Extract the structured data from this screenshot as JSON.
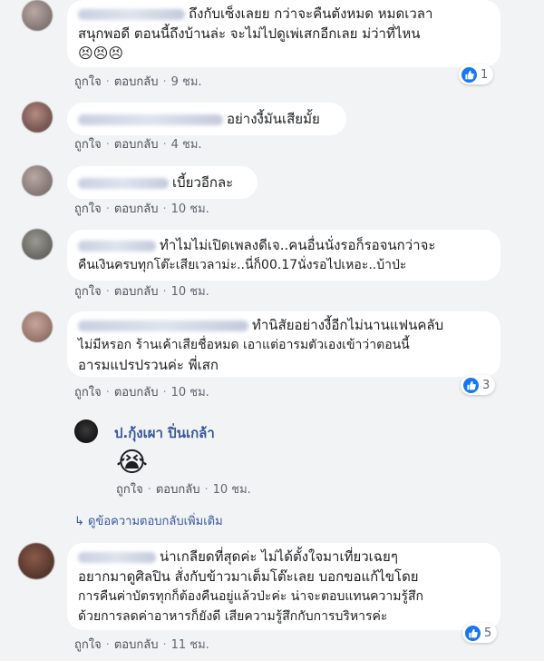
{
  "comments": [
    {
      "lines": [
        "ถึงกับเซ็งเลยย กว่าจะคืนตังหมด หมดเวลา",
        "สนุกพอดี ตอนนี้ถึงบ้านล่ะ จะไม่ไปดูเพ่เสกอีกเลย ม่ว่าที่ไหน",
        "😣😣😣"
      ],
      "like": "ถูกใจ",
      "reply": "ตอบกลับ",
      "time": "9 ชม.",
      "reactions": "1"
    },
    {
      "lines": [
        "อย่างงี้มันเสียมั้ย"
      ],
      "like": "ถูกใจ",
      "reply": "ตอบกลับ",
      "time": "4 ชม."
    },
    {
      "lines": [
        "เบี้ยวอีกละ"
      ],
      "like": "ถูกใจ",
      "reply": "ตอบกลับ",
      "time": "10 ชม."
    },
    {
      "lines": [
        "ทำไมไม่เปิดเพลงดีเจ..คนอื่นนั่งรอก็รอจนกว่าจะ",
        "คืนเงินครบทุกโต๊ะเสียเวลาม่ะ..นี่ก็00.17นั่งรอไปเหอะ..บ้าป่ะ"
      ],
      "like": "ถูกใจ",
      "reply": "ตอบกลับ",
      "time": "10 ชม."
    },
    {
      "lines": [
        "ทำนิสัยอย่างงี้อีกไม่นานแฟนคลับ",
        "ไม่มีหรอก ร้านเค้าเสียชื่อหมด เอาแต่อารมตัวเองเข้าว่าตอนนี้",
        "อารมแปรปรวนค่ะ พี่เสก"
      ],
      "like": "ถูกใจ",
      "reply": "ตอบกลับ",
      "time": "10 ชม.",
      "reactions": "3"
    },
    {
      "lines": [
        "น่าเกลียดที่สุดค่ะ ไม่ได้ตั้งใจมาเที่ยวเฉยๆ",
        "อยากมาดูศิลปิน สั่งกับข้าวมาเต็มโต๊ะเลย บอกขอแก้ไขโดย",
        "การคืนค่าบัตรทุกก็ต้องคืนอยู่แล้วป่ะค่ะ น่าจะตอบแทนความรู้สึก",
        "ด้วยการลดค่าอาหารก็ยังดี เสียความรู้สึกกับการบริหารค่ะ"
      ],
      "like": "ถูกใจ",
      "reply": "ตอบกลับ",
      "time": "11 ชม.",
      "reactions": "5"
    }
  ],
  "reply": {
    "name": "ป.กุ้งเผา ปิ่นเกล้า",
    "emoji": "😭",
    "like": "ถูกใจ",
    "reply": "ตอบกลับ",
    "time": "10 ชม."
  },
  "more_replies": "↳ ดูข้อความตอบกลับเพิ่มเติม",
  "colors": {
    "link": "#365899",
    "like_blue": "#1877f2",
    "bg": "#f2f3f5"
  }
}
